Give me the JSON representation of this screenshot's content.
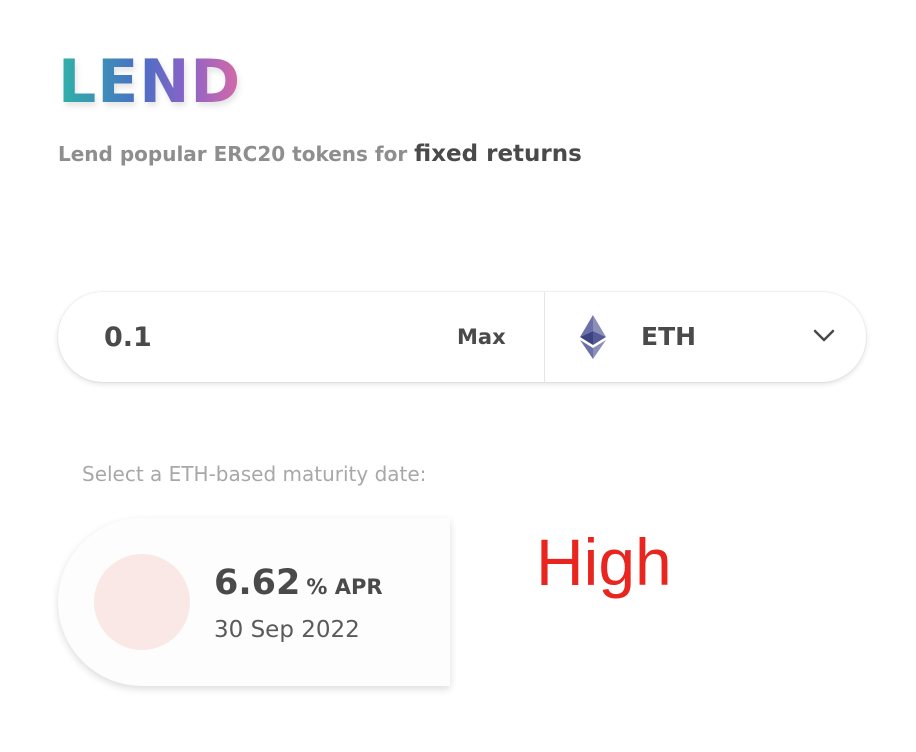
{
  "header": {
    "title": "LEND",
    "subtitle_prefix": "Lend popular ERC20 tokens for ",
    "subtitle_emphasis": "fixed returns"
  },
  "lend_form": {
    "amount_value": "0.1",
    "max_label": "Max",
    "token": {
      "symbol": "ETH",
      "icon": "ethereum-icon"
    },
    "dropdown_icon": "chevron-down-icon"
  },
  "maturity": {
    "label": "Select a ETH-based maturity date:",
    "options": [
      {
        "apr_value": "6.62",
        "apr_unit": "% APR",
        "date": "30 Sep 2022",
        "dot_color": "#f9e8e6"
      }
    ]
  },
  "annotation": {
    "risk_label": "High",
    "color": "#e8251f"
  },
  "colors": {
    "title_gradient": [
      "#2fb3a8",
      "#4a6fc4",
      "#8a63c8",
      "#d66aa6"
    ],
    "text_dark": "#4a4a4a",
    "text_muted": "#a8a8a8"
  }
}
